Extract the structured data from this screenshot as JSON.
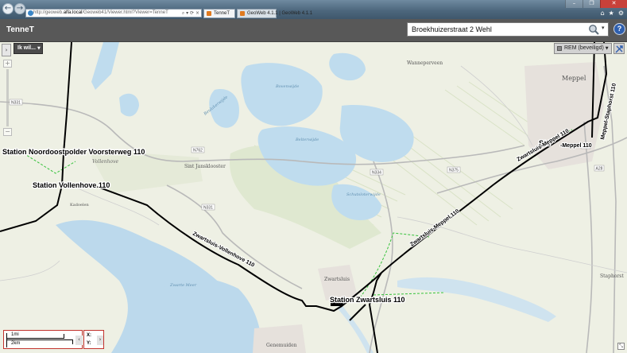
{
  "browser": {
    "address": {
      "prefix": "http://geoweb.",
      "domain": "alfa.local",
      "path": "/Geoweb41/Viewer.html?Viewer=TenneT"
    },
    "address_tools": "⌕ ▾ ⟳ ×",
    "tabs": [
      {
        "label": "TenneT",
        "active": true
      },
      {
        "label": "GeoWeb 4.1.1 | GeoWeb 4.1.1",
        "active": false
      }
    ],
    "window_controls": [
      "–",
      "❐",
      "✕"
    ],
    "toolbar_icons": [
      "home-icon",
      "star-icon",
      "gear-icon"
    ],
    "toolbar_glyphs": [
      "⌂",
      "★",
      "⚙"
    ]
  },
  "app": {
    "title": "TenneT",
    "search": {
      "value": "Broekhuizerstraat 2 Wehl"
    },
    "help_label": "?"
  },
  "map": {
    "menu_button": "Ik wil...",
    "expand_label": "›",
    "zoom": {
      "in": "+",
      "out": "−"
    },
    "layer_select": "REM (beveiligd)",
    "places": {
      "vollenhove": "Vollenhove",
      "sint_jansklooster": "Sint Jansklooster",
      "wanneperveen": "Wanneperveen",
      "meppel": "Meppel",
      "zwartsluis": "Zwartsluis",
      "genemuiden": "Genemuiden",
      "staphorst": "Staphorst",
      "kadoelen": "Kadoelen"
    },
    "waters": {
      "bovenwijde": "Bovenwijde",
      "belterwijde": "Belterwijde",
      "schutsloterwijde": "Schutsloterwijde",
      "beulakerwijde": "Beulakerwijde",
      "zwarte_meer": "Zwarte Meer"
    },
    "roads": {
      "n762": "N762",
      "n334": "N334",
      "n375": "N375",
      "n331": "N331",
      "a32": "A32",
      "a28": "A28",
      "n331b": "N331"
    },
    "stations": {
      "noordoostpolder": "Station Noordoostpolder Voorsterweg 110",
      "vollenhove": "Station Vollenhove 110",
      "zwartsluis": "Station Zwartsluis 110",
      "meppel": "Sta"
    },
    "lines": {
      "zwartsluis_vollenhove": "Zwartsluis-Vollenhove 110",
      "zwartsluis_meppel_a": "Zwartsluis-Meppel 110",
      "zwartsluis_meppel_b": "Zwartsluis-Meppel 110",
      "meppel_staphorst": "Meppel-Staphorst 110",
      "meppel_suffix": "-Meppel 110"
    },
    "scale": {
      "mi": "1mi",
      "km": "2km",
      "collapse": "‹"
    },
    "coords": {
      "x": "X:",
      "y": "Y:",
      "expand": "›"
    },
    "resize": "⤡"
  }
}
